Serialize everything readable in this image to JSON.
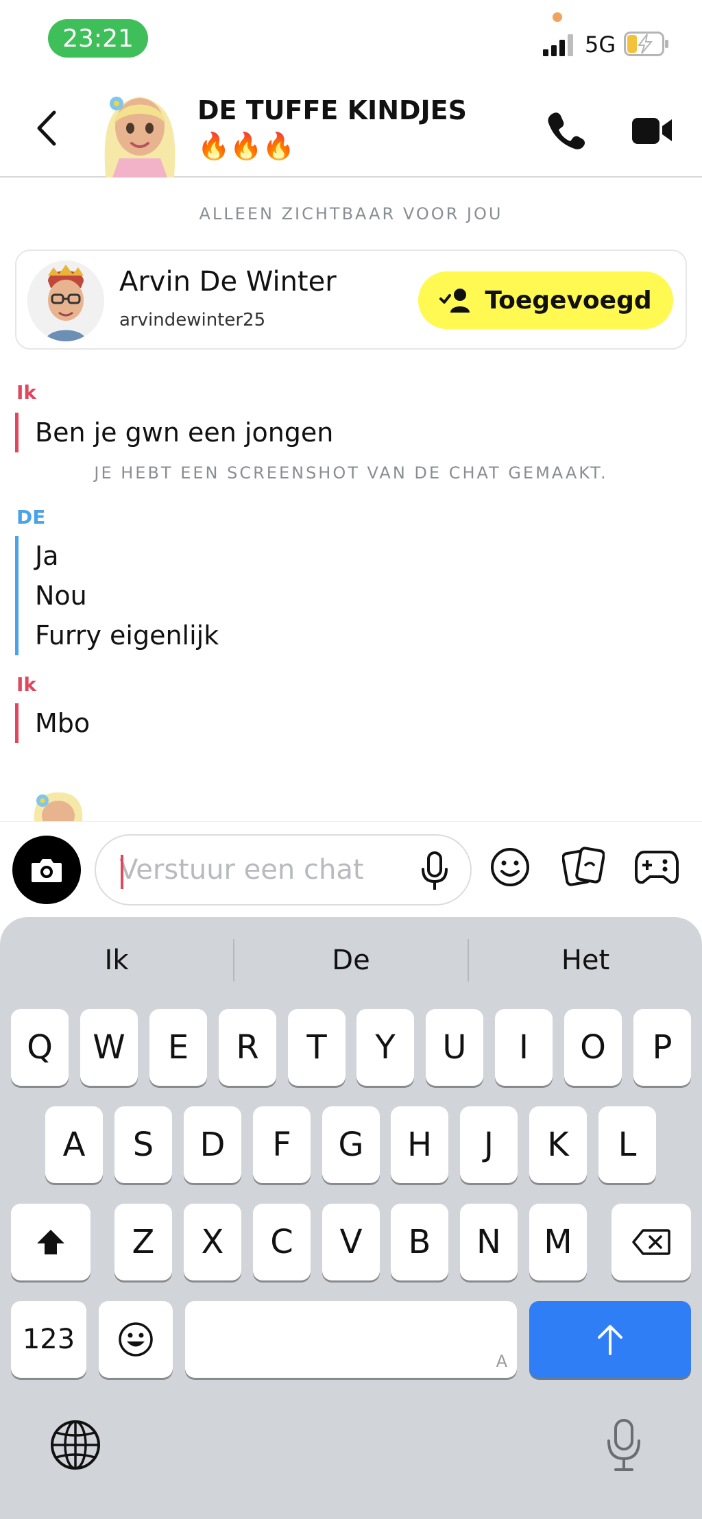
{
  "status_bar": {
    "time": "23:21",
    "network": "5G",
    "battery_charging": true
  },
  "header": {
    "title": "DE TUFFE KINDJES🔥🔥🔥",
    "back_icon": "chevron-left-icon",
    "call_icon": "phone-icon",
    "video_icon": "video-camera-icon"
  },
  "notices": {
    "only_visible": "ALLEEN ZICHTBAAR VOOR JOU",
    "screenshot": "JE HEBT EEN SCREENSHOT VAN DE CHAT GEMAAKT."
  },
  "friend_card": {
    "name": "Arvin De Winter",
    "username": "arvindewinter25",
    "button_label": "Toegevoegd",
    "button_color": "#fff952"
  },
  "messages": [
    {
      "sender": "Ik",
      "lines": [
        "Ben je gwn een jongen"
      ]
    },
    {
      "sender": "DE",
      "lines": [
        "Ja",
        "Nou",
        "Furry eigenlijk"
      ]
    },
    {
      "sender": "Ik",
      "lines": [
        "Mbo"
      ]
    }
  ],
  "composer": {
    "placeholder": "Verstuur een chat",
    "value": ""
  },
  "keyboard": {
    "suggestions": [
      "Ik",
      "De",
      "Het"
    ],
    "row1": [
      "Q",
      "W",
      "E",
      "R",
      "T",
      "Y",
      "U",
      "I",
      "O",
      "P"
    ],
    "row2": [
      "A",
      "S",
      "D",
      "F",
      "G",
      "H",
      "J",
      "K",
      "L"
    ],
    "row3": [
      "Z",
      "X",
      "C",
      "V",
      "B",
      "N",
      "M"
    ],
    "numbers_label": "123",
    "space_hint": "A"
  },
  "colors": {
    "me": "#e0475d",
    "other": "#4aa3e8",
    "return_key": "#2f7ef5",
    "time_pill": "#3fbf5a"
  }
}
